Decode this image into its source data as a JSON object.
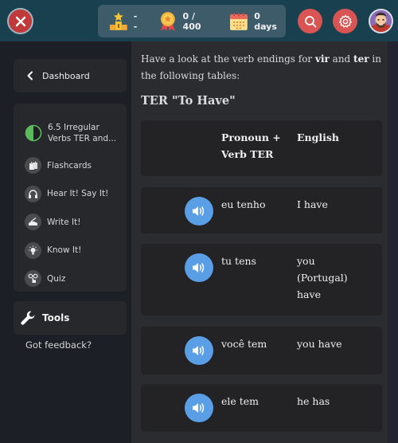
{
  "topbar": {
    "close_icon": "close-icon",
    "stats": {
      "rank": {
        "icon": "podium-trophy-icon",
        "value": "--"
      },
      "points": {
        "icon": "medal-icon",
        "value": "0 / 400"
      },
      "streak": {
        "icon": "calendar-icon",
        "value": "0 days"
      }
    },
    "search_icon": "search-icon",
    "settings_icon": "gear-icon",
    "avatar_icon": "user-avatar"
  },
  "sidebar": {
    "dashboard_label": "Dashboard",
    "items": [
      {
        "label": "6.5 Irregular Verbs TER and...",
        "icon": "progress-half-circle-icon"
      },
      {
        "label": "Flashcards",
        "icon": "flashcards-icon"
      },
      {
        "label": "Hear It! Say It!",
        "icon": "headphones-icon"
      },
      {
        "label": "Write It!",
        "icon": "writing-hand-icon"
      },
      {
        "label": "Know It!",
        "icon": "lightbulb-icon"
      },
      {
        "label": "Quiz",
        "icon": "quiz-pointer-icon"
      }
    ],
    "tools_label": "Tools",
    "feedback_label": "Got feedback?"
  },
  "main": {
    "intro": {
      "part1": "Have a look at the verb endings for ",
      "bold1": "vir",
      "part2": " and ",
      "bold2": "ter",
      "part3": " in the following tables:"
    },
    "section_title": "TER \"To Have\"",
    "table": {
      "headers": [
        "Pronoun + Verb TER",
        "English"
      ],
      "rows": [
        {
          "portuguese": "eu tenho",
          "english": "I have"
        },
        {
          "portuguese": "tu tens",
          "english": "you (Portugal) have"
        },
        {
          "portuguese": "você tem",
          "english": "you have"
        },
        {
          "portuguese": "ele tem",
          "english": "he has"
        }
      ]
    }
  },
  "colors": {
    "topbar": "#19404f",
    "accent_red": "#d85553",
    "speaker_blue": "#5a9fe6",
    "progress_green": "#5cb85c"
  }
}
